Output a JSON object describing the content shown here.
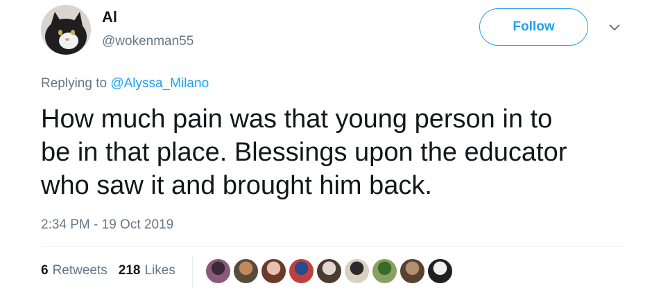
{
  "tweet": {
    "display_name": "Al",
    "handle": "@wokenman55",
    "follow_label": "Follow",
    "replying_prefix": "Replying to",
    "replying_to": "@Alyssa_Milano",
    "text": "How much pain was that young person in to\nbe in that place. Blessings upon the educator\nwho saw it and brought him back.",
    "timestamp": "2:34 PM - 19 Oct 2019",
    "retweets_count": "6",
    "retweets_label": "Retweets",
    "likes_count": "218",
    "likes_label": "Likes"
  },
  "icons": {
    "more": "chevron-down-icon"
  },
  "colors": {
    "accent": "#1da1f2",
    "secondary_text": "#657786",
    "primary_text": "#14171a",
    "divider": "#e6ecf0"
  },
  "likers": [
    {
      "color_a": "#3a2a3a",
      "color_b": "#8a5a7a"
    },
    {
      "color_a": "#c08a5a",
      "color_b": "#5a4a3a"
    },
    {
      "color_a": "#e8c0b0",
      "color_b": "#6a3a2a"
    },
    {
      "color_a": "#2a4a8a",
      "color_b": "#c04040"
    },
    {
      "color_a": "#e0d8d0",
      "color_b": "#4a3a30"
    },
    {
      "color_a": "#2a2a2a",
      "color_b": "#d8d0c0"
    },
    {
      "color_a": "#3a6a2a",
      "color_b": "#8aa060"
    },
    {
      "color_a": "#b09070",
      "color_b": "#5a4030"
    },
    {
      "color_a": "#f0f0f0",
      "color_b": "#202020"
    }
  ]
}
